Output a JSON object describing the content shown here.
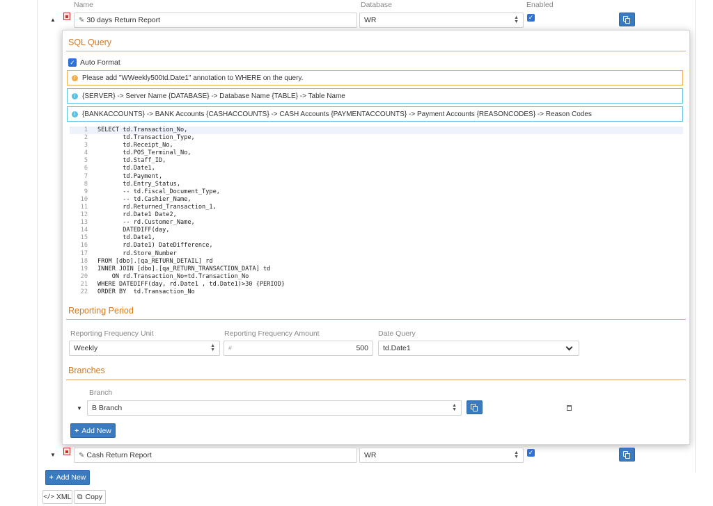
{
  "columns": {
    "name": "Name",
    "database": "Database",
    "enabled": "Enabled"
  },
  "reports": [
    {
      "name": "30 days Return Report",
      "database": "WR",
      "enabled": true,
      "expanded": true
    },
    {
      "name": "Cash Return Report",
      "database": "WR",
      "enabled": true,
      "expanded": false
    }
  ],
  "sql": {
    "title": "SQL Query",
    "auto_format_label": "Auto Format",
    "auto_format_checked": true,
    "warning": "Please add \"WWeekly500td.Date1\" annotation to WHERE on the query.",
    "info1": "{SERVER} -> Server Name {DATABASE} -> Database Name {TABLE} -> Table Name",
    "info2": "{BANKACCOUNTS} -> BANK Accounts {CASHACCOUNTS} -> CASH Accounts {PAYMENTACCOUNTS} -> Payment Accounts {REASONCODES} -> Reason Codes",
    "lines": [
      "SELECT td.Transaction_No,",
      "       td.Transaction_Type,",
      "       td.Receipt_No,",
      "       td.POS_Terminal_No,",
      "       td.Staff_ID,",
      "       td.Date1,",
      "       td.Payment,",
      "       td.Entry_Status,",
      "       -- td.Fiscal_Document_Type,",
      "       -- td.Cashier_Name,",
      "       rd.Returned_Transaction_1,",
      "       rd.Date1 Date2,",
      "       -- rd.Customer_Name,",
      "       DATEDIFF(day,",
      "       td.Date1,",
      "       rd.Date1) DateDifference,",
      "       rd.Store_Number",
      "FROM [dbo].[qa_RETURN_DETAIL] rd",
      "INNER JOIN [dbo].[qa_RETURN_TRANSACTION_DATA] td",
      "    ON rd.Transaction_No=td.Transaction_No",
      "WHERE DATEDIFF(day, rd.Date1 , td.Date1)>30 {PERIOD}",
      "ORDER BY  td.Transaction_No"
    ]
  },
  "reporting": {
    "title": "Reporting Period",
    "unit_label": "Reporting Frequency Unit",
    "unit_value": "Weekly",
    "amount_label": "Reporting Frequency Amount",
    "amount_placeholder": "#",
    "amount_value": "500",
    "date_label": "Date Query",
    "date_value": "td.Date1"
  },
  "branches": {
    "title": "Branches",
    "column": "Branch",
    "items": [
      {
        "name": "B Branch"
      }
    ],
    "add_label": "Add New"
  },
  "footer": {
    "add_label": "Add New",
    "xml_label": "XML",
    "copy_label": "Copy"
  },
  "colors": {
    "accent": "#d2781f",
    "primary": "#3a7bbf",
    "warning": "#f0ad4e",
    "info": "#5bc0de"
  }
}
